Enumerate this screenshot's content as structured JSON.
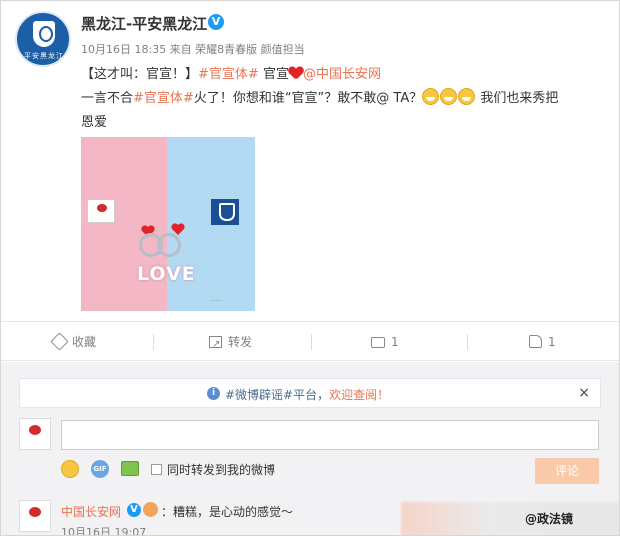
{
  "post": {
    "author": "黑龙江-平安黑龙江",
    "avatar_caption": "平安黑龙江",
    "meta": "10月16日 18:35 来自 荣耀8青春版 颜值担当",
    "line1_prefix": "【这才叫：官宣！】",
    "line1_tag": "#官宣体#",
    "line1_mid": " 官宣",
    "line1_at": "@中国长安网",
    "line2_prefix": "一言不合",
    "line2_tag": "#官宣体#",
    "line2_rest": "火了！你想和谁“官宣”？敢不敢@ TA？",
    "line2_suffix": " 我们也来秀把",
    "line3": "恩爱",
    "image_text": "LOVE"
  },
  "actions": {
    "favorite": "收藏",
    "forward": "转发",
    "comment_count": "1",
    "like_count": "1"
  },
  "notice": {
    "prefix": "#微博辟谣#平台，",
    "highlight": "欢迎查阅！",
    "close": "×"
  },
  "composer": {
    "input_value": "",
    "gif_label": "GIF",
    "forward_option": "同时转发到我的微博",
    "submit": "评论"
  },
  "comment": {
    "author": "中国长安网",
    "text": "：糟糕，是心动的感觉～",
    "time": "10月16日 19:07"
  },
  "watermark": "@政法镜"
}
